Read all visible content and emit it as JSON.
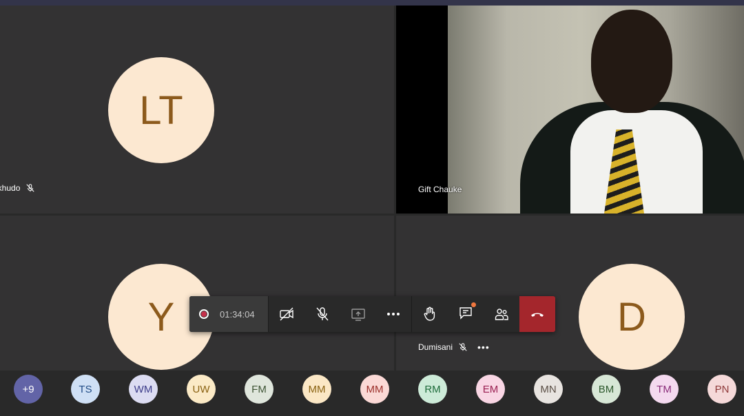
{
  "tiles": {
    "top_left": {
      "initials": "LT",
      "name": "ikhudo"
    },
    "top_right": {
      "name": "Gift Chauke"
    },
    "bottom_left": {
      "initials": "Y"
    },
    "bottom_right": {
      "initials": "D",
      "name": "Dumisani",
      "more": "•••"
    }
  },
  "callbar": {
    "timer": "01:34:04"
  },
  "colors": {
    "avatar_bg": "#fce8d1",
    "avatar_fg": "#8c5a1c",
    "end_call": "#a4262c",
    "more_participants": "#6264a7"
  },
  "participants": [
    {
      "initials": "+9",
      "bg": "#6264a7",
      "fg": "#ffffff"
    },
    {
      "initials": "TS",
      "bg": "#cfe0f5",
      "fg": "#1f4b85"
    },
    {
      "initials": "WM",
      "bg": "#dcdcf2",
      "fg": "#3d3d8a"
    },
    {
      "initials": "UW",
      "bg": "#fbeac6",
      "fg": "#8a6212"
    },
    {
      "initials": "FM",
      "bg": "#dfe6dc",
      "fg": "#3e5435"
    },
    {
      "initials": "MM",
      "bg": "#fbe7c5",
      "fg": "#8a6212"
    },
    {
      "initials": "MM",
      "bg": "#fbd9d6",
      "fg": "#9b2f2a"
    },
    {
      "initials": "RM",
      "bg": "#cdebd8",
      "fg": "#1e6b3a"
    },
    {
      "initials": "EM",
      "bg": "#f9d6e4",
      "fg": "#9a2052"
    },
    {
      "initials": "MN",
      "bg": "#e8e4e0",
      "fg": "#5a4e45"
    },
    {
      "initials": "BM",
      "bg": "#d7e7d6",
      "fg": "#2f5a2e"
    },
    {
      "initials": "TM",
      "bg": "#f4d9ef",
      "fg": "#8a2d7a"
    },
    {
      "initials": "PN",
      "bg": "#f5d9d9",
      "fg": "#8f3a3a"
    }
  ]
}
